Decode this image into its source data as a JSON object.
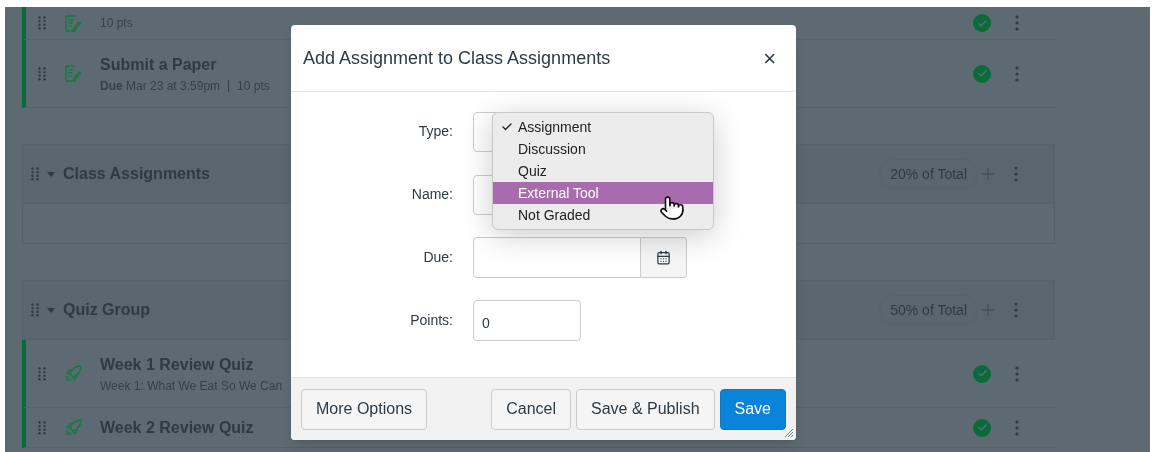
{
  "rows": [
    {
      "kind": "assignment",
      "points": "10 pts",
      "published": true
    },
    {
      "kind": "assignment",
      "title": "Submit a Paper",
      "due_label": "Due",
      "due": "Mar 23 at 3:59pm",
      "points": "10 pts",
      "published": true
    },
    {
      "kind": "group",
      "title": "Class Assignments",
      "weight": "20% of Total",
      "expanded": true
    },
    {
      "kind": "empty"
    },
    {
      "kind": "group",
      "title": "Quiz Group",
      "weight": "50% of Total",
      "expanded": true
    },
    {
      "kind": "quiz",
      "title": "Week 1 Review Quiz",
      "subtitle": "Week 1: What We Eat So We Can",
      "published": true
    },
    {
      "kind": "quiz",
      "title": "Week 2 Review Quiz",
      "published": true
    }
  ],
  "dialog": {
    "title": "Add Assignment to Class Assignments",
    "close": "×",
    "fields": [
      {
        "kind": "select",
        "label": "Type:",
        "options": [
          {
            "label": "Assignment",
            "selected": true,
            "hovered": false
          },
          {
            "label": "Discussion",
            "selected": false,
            "hovered": false
          },
          {
            "label": "Quiz",
            "selected": false,
            "hovered": false
          },
          {
            "label": "External Tool",
            "selected": false,
            "hovered": true
          },
          {
            "label": "Not Graded",
            "selected": false,
            "hovered": false
          }
        ]
      },
      {
        "kind": "text",
        "label": "Name:"
      },
      {
        "kind": "date",
        "label": "Due:"
      },
      {
        "kind": "number",
        "label": "Points:",
        "value": "0"
      }
    ],
    "buttons": [
      {
        "label": "More Options",
        "kind": "secondary"
      },
      {
        "label": "Cancel",
        "kind": "secondary"
      },
      {
        "label": "Save & Publish",
        "kind": "secondary"
      },
      {
        "label": "Save",
        "kind": "primary"
      }
    ]
  }
}
